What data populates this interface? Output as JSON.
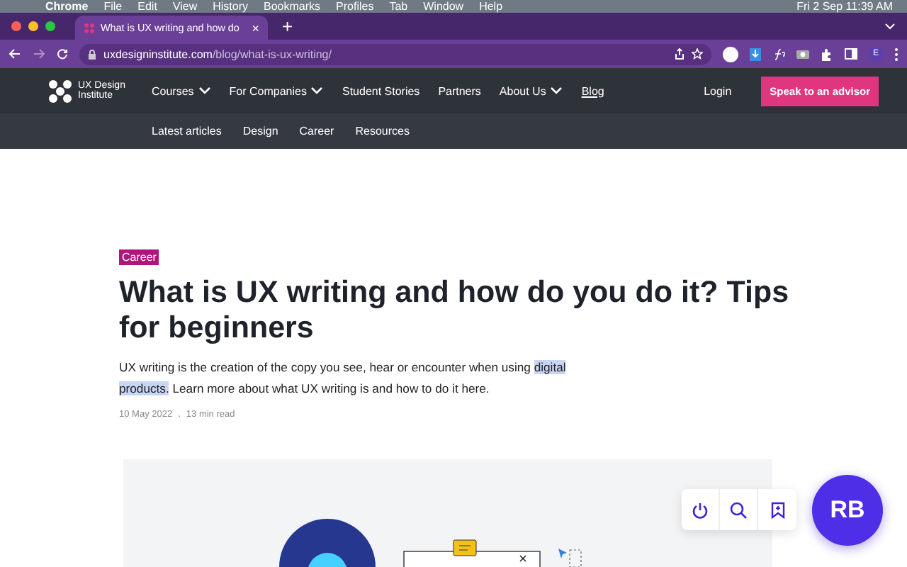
{
  "menu_bar": {
    "app": "Chrome",
    "items": [
      "File",
      "Edit",
      "View",
      "History",
      "Bookmarks",
      "Profiles",
      "Tab",
      "Window",
      "Help"
    ],
    "clock": "Fri 2 Sep  11:39 AM"
  },
  "browser": {
    "tab": {
      "title": "What is UX writing and how do",
      "close": "×"
    },
    "new_tab": "+",
    "url_host": "uxdesigninstitute.com",
    "url_path": "/blog/what-is-ux-writing/",
    "profile": "E"
  },
  "site_nav": {
    "logo": "UX Design Institute",
    "items": [
      {
        "label": "Courses",
        "dropdown": true,
        "selected": false
      },
      {
        "label": "For Companies",
        "dropdown": true,
        "selected": false
      },
      {
        "label": "Student Stories",
        "dropdown": false,
        "selected": false
      },
      {
        "label": "Partners",
        "dropdown": false,
        "selected": false
      },
      {
        "label": "About Us",
        "dropdown": true,
        "selected": false
      },
      {
        "label": "Blog",
        "dropdown": false,
        "selected": true
      }
    ],
    "login": "Login",
    "cta": "Speak to an advisor"
  },
  "sub_nav": [
    "Latest articles",
    "Design",
    "Career",
    "Resources"
  ],
  "article": {
    "tag": "Career",
    "title": "What is UX writing and how do you do it? Tips for beginners",
    "intro_before": "UX writing is the creation of the copy you see, hear or encounter when using ",
    "intro_selected": "digital products.",
    "intro_after": " Learn more about what UX writing is and how to do it here.",
    "date": "10 May 2022",
    "separator": ".",
    "read_time": "13 min read"
  },
  "extension": {
    "badge": "RB"
  }
}
